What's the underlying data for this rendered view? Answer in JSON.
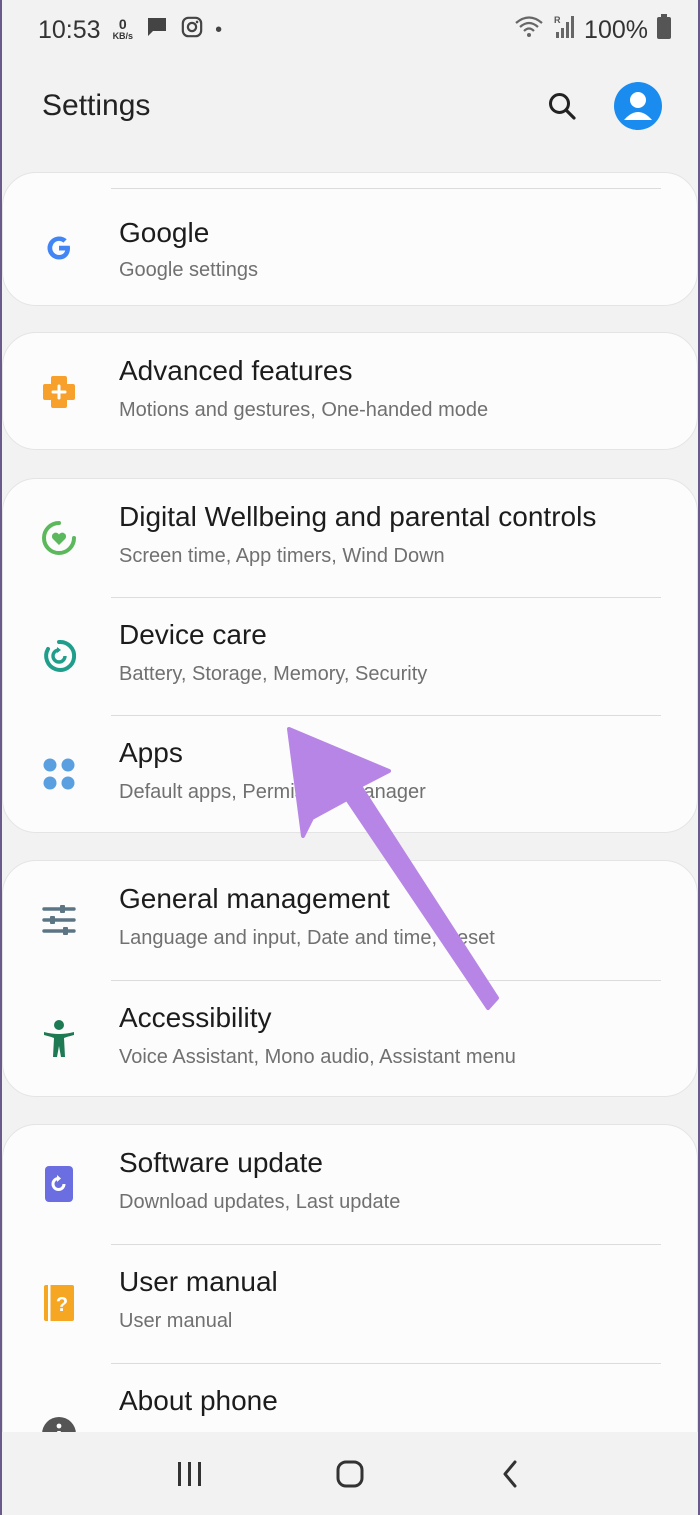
{
  "status_bar": {
    "time": "10:53",
    "net_speed_value": "0",
    "net_speed_unit": "KB/s",
    "dot": "•",
    "battery": "100%",
    "icons": [
      "message-icon",
      "instagram-icon",
      "wifi-icon",
      "signal-icon",
      "battery-icon"
    ]
  },
  "header": {
    "title": "Settings"
  },
  "settings": {
    "google": {
      "title": "Google",
      "subtitle": "Google settings",
      "icon": "google-icon",
      "color": "#4285f4"
    },
    "advanced": {
      "title": "Advanced features",
      "subtitle": "Motions and gestures, One-handed mode",
      "icon": "puzzle-plus-icon",
      "color": "#f7a12c"
    },
    "wellbeing": {
      "title": "Digital Wellbeing and parental controls",
      "subtitle": "Screen time, App timers, Wind Down",
      "icon": "heart-ring-icon",
      "color": "#5cb85c"
    },
    "device_care": {
      "title": "Device care",
      "subtitle": "Battery, Storage, Memory, Security",
      "icon": "refresh-ring-icon",
      "color": "#1f9e8b"
    },
    "apps": {
      "title": "Apps",
      "subtitle": "Default apps, Permission manager",
      "icon": "four-dots-icon",
      "color": "#5a9fe0"
    },
    "general": {
      "title": "General management",
      "subtitle": "Language and input, Date and time, Reset",
      "icon": "sliders-icon",
      "color": "#5b7585"
    },
    "accessibility": {
      "title": "Accessibility",
      "subtitle": "Voice Assistant, Mono audio, Assistant menu",
      "icon": "person-icon",
      "color": "#1e7a52"
    },
    "software_update": {
      "title": "Software update",
      "subtitle": "Download updates, Last update",
      "icon": "update-icon",
      "color": "#6a6ee0"
    },
    "user_manual": {
      "title": "User manual",
      "subtitle": "User manual",
      "icon": "manual-icon",
      "color": "#f5a623"
    },
    "about": {
      "title": "About phone",
      "icon": "info-icon",
      "color": "#555555"
    }
  },
  "annotation": {
    "arrow_color": "#b785e5"
  },
  "nav": {
    "buttons": [
      "recents-icon",
      "home-icon",
      "back-icon"
    ]
  }
}
